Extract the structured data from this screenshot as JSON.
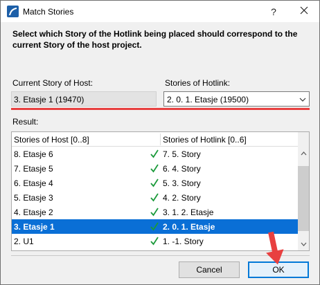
{
  "window": {
    "title": "Match Stories",
    "help_glyph": "?"
  },
  "instruction": "Select which Story of the Hotlink being placed should correspond to the current Story of the host project.",
  "host": {
    "label": "Current Story of Host:",
    "value": "3. Etasje 1 (19470)"
  },
  "hotlink": {
    "label": "Stories of Hotlink:",
    "selected": "2. 0. 1. Etasje (19500)"
  },
  "result": {
    "label": "Result:",
    "columns": [
      "Stories of Host [0..8]",
      "Stories of Hotlink [0..6]"
    ],
    "rows": [
      {
        "host": "8. Etasje 6",
        "hotlink": "7. 5. Story",
        "matched": true
      },
      {
        "host": "7. Etasje 5",
        "hotlink": "6. 4. Story",
        "matched": true
      },
      {
        "host": "6. Etasje 4",
        "hotlink": "5. 3. Story",
        "matched": true
      },
      {
        "host": "5. Etasje 3",
        "hotlink": "4. 2. Story",
        "matched": true
      },
      {
        "host": "4. Etasje 2",
        "hotlink": "3. 1. 2. Etasje",
        "matched": true
      },
      {
        "host": "3. Etasje 1",
        "hotlink": "2. 0. 1. Etasje",
        "matched": true,
        "selected": true
      },
      {
        "host": "2. U1",
        "hotlink": "1. -1. Story",
        "matched": true
      }
    ]
  },
  "buttons": {
    "cancel": "Cancel",
    "ok": "OK"
  },
  "colors": {
    "selection": "#0a6fd6",
    "check": "#1a9a3a",
    "annotation": "#e84040"
  },
  "icons": [
    "archicad-icon",
    "help-icon",
    "close-icon",
    "chevron-down-icon",
    "check-icon",
    "scroll-up-icon",
    "scroll-down-icon",
    "annotation-arrow-icon"
  ]
}
